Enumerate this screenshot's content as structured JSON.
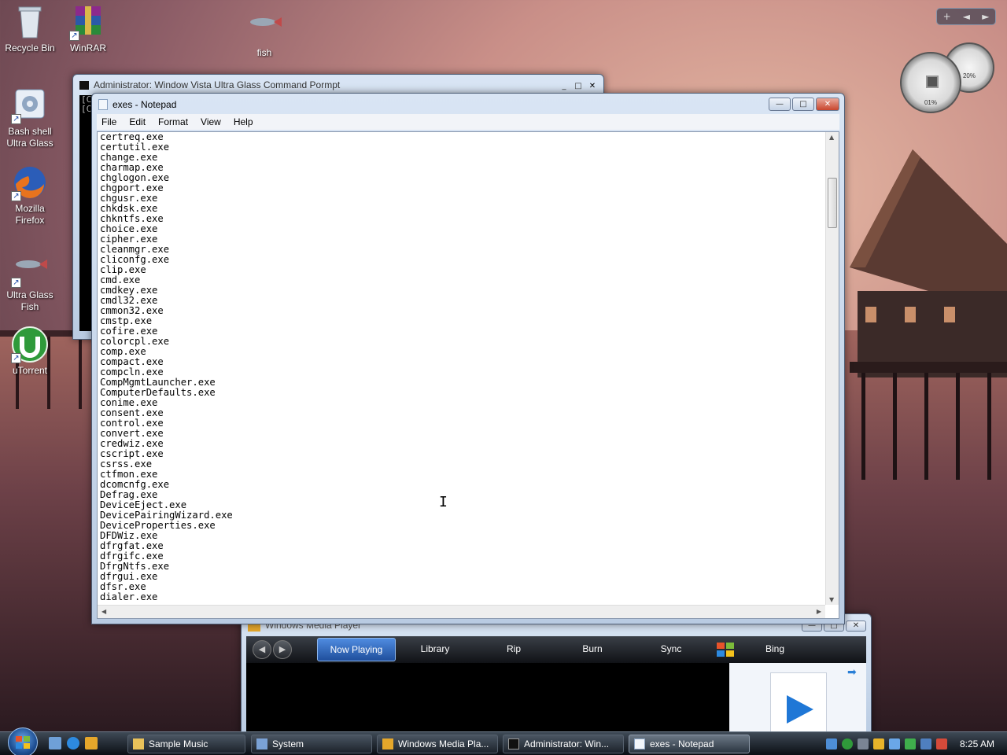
{
  "desktop": {
    "icons": [
      {
        "label": "Recycle Bin",
        "icon": "recycle-bin-icon"
      },
      {
        "label": "WinRAR",
        "icon": "winrar-icon"
      },
      {
        "label": "fish",
        "icon": "fish-icon"
      },
      {
        "label": "Bash shell Ultra Glass",
        "icon": "bash-shell-icon"
      },
      {
        "label": "Mozilla Firefox",
        "icon": "firefox-icon"
      },
      {
        "label": "Ultra Glass Fish",
        "icon": "fish-icon"
      },
      {
        "label": "uTorrent",
        "icon": "utorrent-icon"
      }
    ]
  },
  "gadgets": {
    "cpu_percent": "01%",
    "memory_percent": "20%",
    "toolbar_add": "+",
    "toolbar_prev": "◄",
    "toolbar_next": "►"
  },
  "cmd_window": {
    "title": "Administrator:  Window Vista Ultra Glass Command Pormpt",
    "lines": [
      "[C",
      "[C"
    ]
  },
  "notepad": {
    "title": "exes - Notepad",
    "menu": [
      "File",
      "Edit",
      "Format",
      "View",
      "Help"
    ],
    "lines": [
      "certreq.exe",
      "certutil.exe",
      "change.exe",
      "charmap.exe",
      "chglogon.exe",
      "chgport.exe",
      "chgusr.exe",
      "chkdsk.exe",
      "chkntfs.exe",
      "choice.exe",
      "cipher.exe",
      "cleanmgr.exe",
      "cliconfg.exe",
      "clip.exe",
      "cmd.exe",
      "cmdkey.exe",
      "cmdl32.exe",
      "cmmon32.exe",
      "cmstp.exe",
      "cofire.exe",
      "colorcpl.exe",
      "comp.exe",
      "compact.exe",
      "compcln.exe",
      "CompMgmtLauncher.exe",
      "ComputerDefaults.exe",
      "conime.exe",
      "consent.exe",
      "control.exe",
      "convert.exe",
      "credwiz.exe",
      "cscript.exe",
      "csrss.exe",
      "ctfmon.exe",
      "dcomcnfg.exe",
      "Defrag.exe",
      "DeviceEject.exe",
      "DevicePairingWizard.exe",
      "DeviceProperties.exe",
      "DFDWiz.exe",
      "dfrgfat.exe",
      "dfrgifc.exe",
      "DfrgNtfs.exe",
      "dfrgui.exe",
      "dfsr.exe",
      "dialer.exe"
    ]
  },
  "wmp": {
    "title": "Windows Media Player",
    "tabs": [
      "Now Playing",
      "Library",
      "Rip",
      "Burn",
      "Sync",
      "Bing"
    ],
    "active_tab": "Now Playing"
  },
  "taskbar": {
    "buttons": [
      {
        "label": "Sample Music",
        "icon": "folder-icon",
        "active": false
      },
      {
        "label": "System",
        "icon": "system-icon",
        "active": false
      },
      {
        "label": "Windows Media Pla...",
        "icon": "wmp-icon",
        "active": false
      },
      {
        "label": "Administrator:  Win...",
        "icon": "cmd-icon",
        "active": false
      },
      {
        "label": "exes - Notepad",
        "icon": "notepad-icon",
        "active": true
      }
    ],
    "clock": "8:25 AM"
  }
}
